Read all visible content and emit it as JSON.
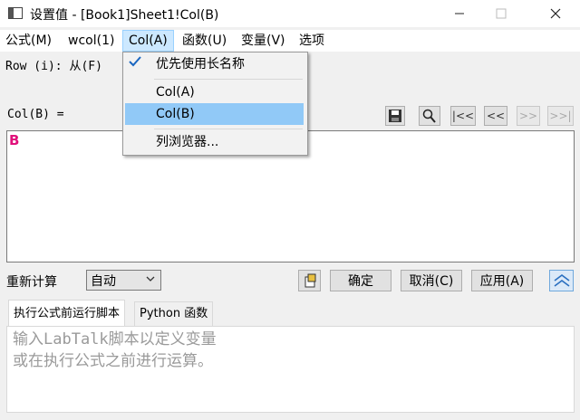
{
  "window": {
    "title": "设置值 - [Book1]Sheet1!Col(B)",
    "minimize_icon": "minimize-icon",
    "maximize_icon": "maximize-icon",
    "close_icon": "close-icon"
  },
  "menubar": {
    "items": [
      "公式(M)",
      "wcol(1)",
      "Col(A)",
      "函数(U)",
      "变量(V)",
      "选项"
    ]
  },
  "row_label": "Row (i): 从(F)",
  "col_label": "Col(B) =",
  "toolbar": {
    "first": "|<<",
    "prev": "<<",
    "next": ">>",
    "last": ">>|"
  },
  "editor": {
    "text": "B"
  },
  "recalc": {
    "label": "重新计算",
    "value": "自动"
  },
  "buttons": {
    "ok": "确定",
    "cancel": "取消(C)",
    "apply": "应用(A)"
  },
  "tabs": [
    "执行公式前运行脚本",
    "Python 函数"
  ],
  "script": {
    "placeholder": "输入LabTalk脚本以定义变量\n或在执行公式之前进行运算。"
  },
  "dropdown": {
    "items": [
      "优先使用长名称",
      "Col(A)",
      "Col(B)",
      "列浏览器..."
    ],
    "checked_item": "优先使用长名称",
    "highlighted_item": "Col(B)"
  },
  "colors": {
    "highlight": "#91c9f7",
    "menu_active": "#cce8ff",
    "editor_text": "#e0107a"
  }
}
